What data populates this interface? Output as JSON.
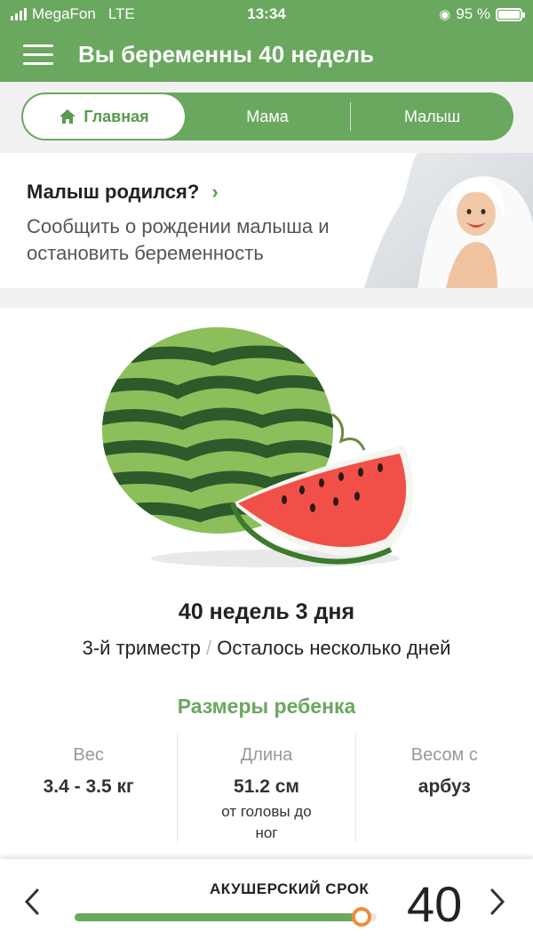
{
  "status_bar": {
    "carrier": "MegaFon",
    "network": "LTE",
    "time": "13:34",
    "battery": "95 %"
  },
  "header": {
    "title": "Вы беременны 40 недель"
  },
  "tabs": [
    {
      "label": "Главная",
      "active": true
    },
    {
      "label": "Мама",
      "active": false
    },
    {
      "label": "Малыш",
      "active": false
    }
  ],
  "born_card": {
    "title": "Малыш родился?",
    "subtitle": "Сообщить о рождении малыша и остановить беременность"
  },
  "pregnancy": {
    "week_title": "40 недель 3 дня",
    "trimester": "3-й триместр",
    "separator": "/",
    "remaining": "Осталось несколько дней",
    "sizes_title": "Размеры ребенка",
    "stats": [
      {
        "label": "Вес",
        "value": "3.4 - 3.5 кг",
        "note": ""
      },
      {
        "label": "Длина",
        "value": "51.2 см",
        "note": "от головы до ног"
      },
      {
        "label": "Весом с",
        "value": "арбуз",
        "note": ""
      }
    ]
  },
  "bottom": {
    "term_label": "АКУШЕРСКИЙ СРОК",
    "week_number": "40",
    "progress": 0.95
  },
  "colors": {
    "brand": "#6aa75f",
    "accent": "#f08b3a"
  },
  "icons": {
    "menu": "hamburger-icon",
    "home": "home-icon",
    "chevron_right": "chevron-right-icon",
    "prev": "chevron-left-icon",
    "next": "chevron-right-icon"
  }
}
